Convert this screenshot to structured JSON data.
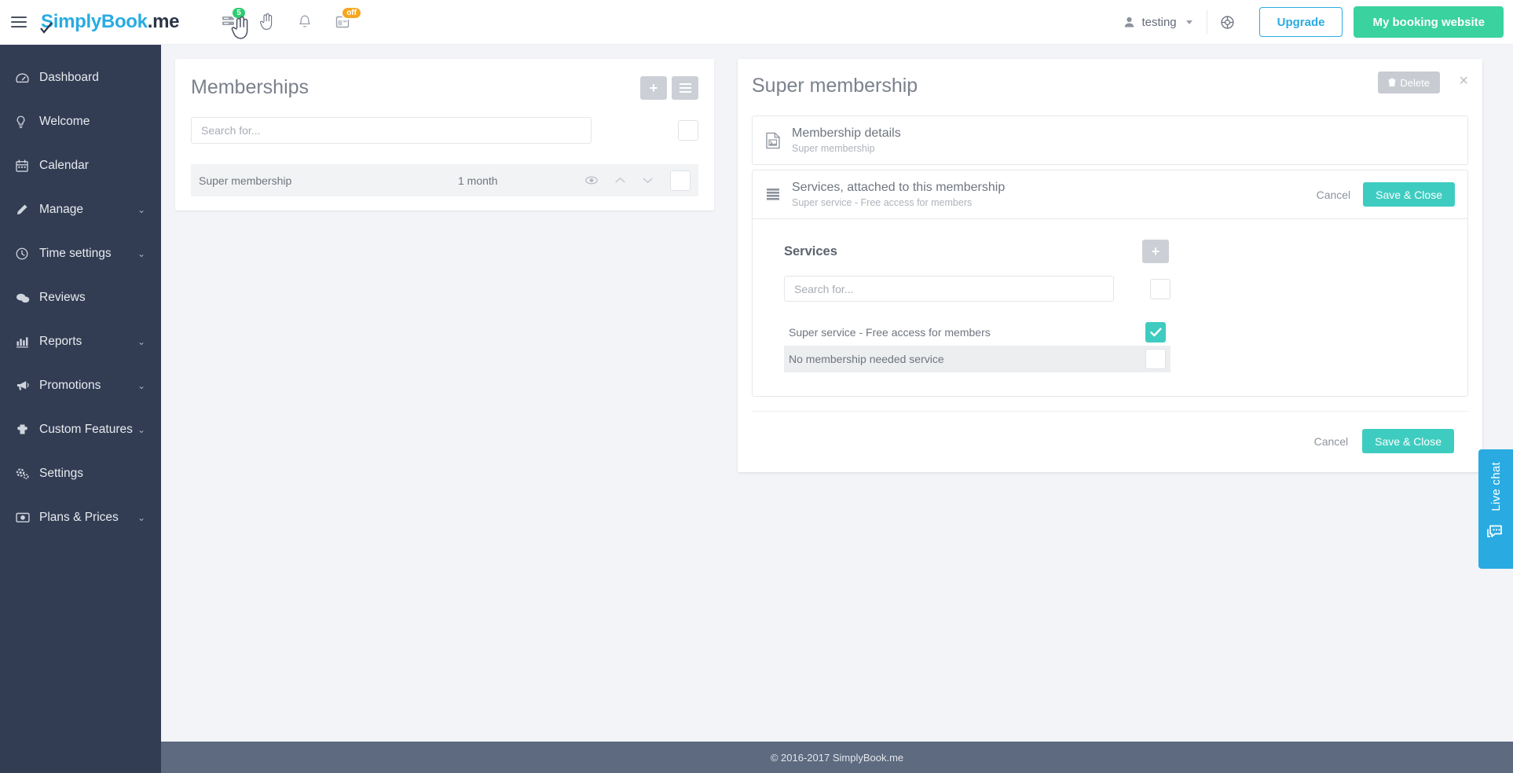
{
  "header": {
    "brand": {
      "simply": "S",
      "simply_rest": "imply",
      "book": "Book",
      "me": ".me"
    },
    "menu_toggle": "menu-toggle",
    "icons": [
      {
        "name": "server-list-icon",
        "badge": "5",
        "badge_color": "#2ecc71"
      },
      {
        "name": "hand-pointer-icon",
        "badge": ""
      },
      {
        "name": "bell-icon",
        "badge": ""
      },
      {
        "name": "calendar-widget-icon",
        "badge": "off",
        "badge_color": "#f5a623"
      }
    ],
    "user": "testing",
    "help_icon": "lifebuoy-icon",
    "upgrade_label": "Upgrade",
    "booking_label": "My booking website",
    "upgrade_color": "#29abe2",
    "booking_color": "#3ad29f"
  },
  "sidebar": {
    "items": [
      {
        "label": "Dashboard",
        "icon": "dashboard-icon",
        "expandable": false
      },
      {
        "label": "Welcome",
        "icon": "bulb-icon",
        "expandable": false
      },
      {
        "label": "Calendar",
        "icon": "calendar-icon",
        "expandable": false
      },
      {
        "label": "Manage",
        "icon": "pencil-icon",
        "expandable": true
      },
      {
        "label": "Time settings",
        "icon": "clock-icon",
        "expandable": true
      },
      {
        "label": "Reviews",
        "icon": "comments-icon",
        "expandable": false
      },
      {
        "label": "Reports",
        "icon": "bar-chart-icon",
        "expandable": true
      },
      {
        "label": "Promotions",
        "icon": "megaphone-icon",
        "expandable": true
      },
      {
        "label": "Custom Features",
        "icon": "puzzle-icon",
        "expandable": true
      },
      {
        "label": "Settings",
        "icon": "gears-icon",
        "expandable": false
      },
      {
        "label": "Plans & Prices",
        "icon": "card-icon",
        "expandable": true
      }
    ]
  },
  "memberships_panel": {
    "title": "Memberships",
    "add_button": "+",
    "list_button": "list",
    "search_placeholder": "Search for...",
    "search_value": "",
    "rows": [
      {
        "name": "Super membership",
        "duration": "1 month",
        "checked": false
      }
    ]
  },
  "detail_panel": {
    "title": "Super membership",
    "delete_label": "Delete",
    "close_label": "×",
    "sections": [
      {
        "title": "Membership details",
        "subtitle": "Super membership",
        "icon": "image-file-icon",
        "expanded": false
      },
      {
        "title": "Services, attached to this membership",
        "subtitle": "Super service - Free access for members",
        "icon": "list-icon",
        "expanded": true,
        "cancel_label": "Cancel",
        "save_label": "Save & Close"
      }
    ],
    "services": {
      "heading": "Services",
      "add_button": "+",
      "search_placeholder": "Search for...",
      "search_value": "",
      "select_all_checked": false,
      "items": [
        {
          "name": "Super service - Free access for members",
          "checked": true,
          "alt": false
        },
        {
          "name": "No membership needed service",
          "checked": false,
          "alt": true
        }
      ]
    },
    "footer": {
      "cancel_label": "Cancel",
      "save_label": "Save & Close"
    },
    "accent_color": "#3fccc0"
  },
  "live_chat": {
    "label": "Live chat",
    "icon": "chat-bubbles-icon",
    "color": "#29abe2"
  },
  "footer": {
    "text": "© 2016-2017 SimplyBook.me"
  }
}
